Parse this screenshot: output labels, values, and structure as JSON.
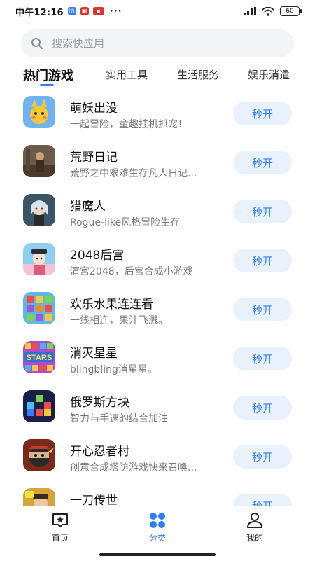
{
  "status_bar": {
    "time": "中午12:16",
    "dots": "···",
    "battery": "60"
  },
  "search": {
    "placeholder": "搜索快应用"
  },
  "tabs": [
    {
      "label": "热门游戏",
      "active": true
    },
    {
      "label": "实用工具"
    },
    {
      "label": "生活服务"
    },
    {
      "label": "娱乐消遣"
    }
  ],
  "open_label": "秒开",
  "apps": [
    {
      "name": "萌妖出没",
      "desc": "一起冒险，童趣挂机抓宠！",
      "icon": "cute-monster-game-icon"
    },
    {
      "name": "荒野日记",
      "desc": "荒野之中艰难生存凡人日记...",
      "icon": "wilderness-survival-game-icon"
    },
    {
      "name": "猎魔人",
      "desc": "Rogue-like风格冒险生存",
      "icon": "demon-hunter-game-icon"
    },
    {
      "name": "2048后宫",
      "desc": "清宫2048，后宫合成小游戏",
      "icon": "palace-2048-game-icon"
    },
    {
      "name": "欢乐水果连连看",
      "desc": "一线相连，果汁飞溅。",
      "icon": "fruit-match-game-icon"
    },
    {
      "name": "消灭星星",
      "desc": "blingbling消星星。",
      "icon": "pop-stars-game-icon"
    },
    {
      "name": "俄罗斯方块",
      "desc": "智力与手速的结合加油",
      "icon": "tetris-game-icon"
    },
    {
      "name": "开心忍者村",
      "desc": "创意合成塔防游戏快来召唤...",
      "icon": "ninja-village-game-icon"
    },
    {
      "name": "一刀传世",
      "desc": "",
      "icon": "blade-legend-game-icon"
    }
  ],
  "bottom_nav": [
    {
      "label": "首页",
      "icon": "home-star-icon"
    },
    {
      "label": "分类",
      "icon": "category-grid-icon",
      "active": true
    },
    {
      "label": "我的",
      "icon": "profile-icon"
    }
  ],
  "colors": {
    "accent": "#2f7df6",
    "button_bg": "#e9f1fd"
  }
}
